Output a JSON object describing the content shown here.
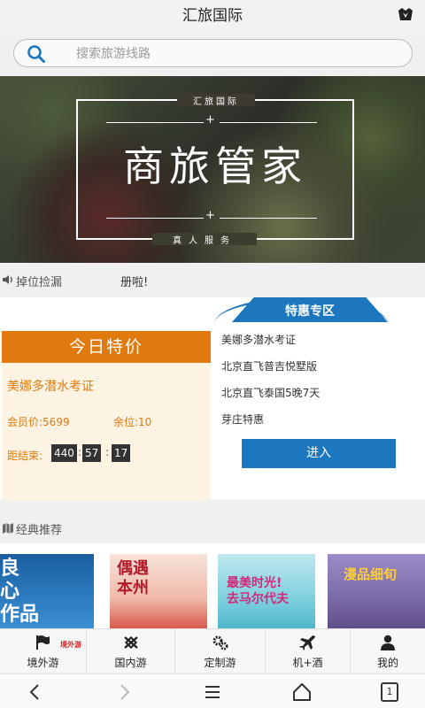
{
  "header": {
    "title": "汇旅国际"
  },
  "search": {
    "placeholder": "搜索旅游线路"
  },
  "banner": {
    "brand_small": "汇旅国际",
    "headline": "商旅管家",
    "tagline": "真人服务"
  },
  "notice": {
    "label": "掉位捡漏",
    "message": "册啦!"
  },
  "today_special": {
    "title": "今日特价",
    "product": "美娜多潜水考证",
    "member_price": "会员价:5699",
    "seats": "余位:10",
    "countdown_label": "距结束:",
    "countdown": [
      "440",
      "57",
      "17"
    ]
  },
  "special_zone": {
    "title": "特惠专区",
    "items": [
      "美娜多潜水考证",
      "北京直飞普吉悦墅版",
      "北京直飞泰国5晚7天",
      "芽庄特惠"
    ],
    "enter_label": "进入"
  },
  "classics": {
    "label": "经典推荐",
    "cards": [
      {
        "text": "良\n心\n作品"
      },
      {
        "text": "偶遇\n本州"
      },
      {
        "text": "最美时光!\n去马尔代夫"
      },
      {
        "text": "漫品细旬"
      }
    ]
  },
  "tabs": [
    {
      "label": "境外游",
      "icon": "flag-icon"
    },
    {
      "label": "国内游",
      "icon": "knot-icon"
    },
    {
      "label": "定制游",
      "icon": "gears-icon"
    },
    {
      "label": "机+酒",
      "icon": "airplane-icon"
    },
    {
      "label": "我的",
      "icon": "person-icon"
    }
  ],
  "tab_badge": "境外游",
  "system_nav": {
    "tab_count": "1"
  },
  "colors": {
    "accent_orange": "#e07a0e",
    "accent_blue": "#1c77be"
  }
}
